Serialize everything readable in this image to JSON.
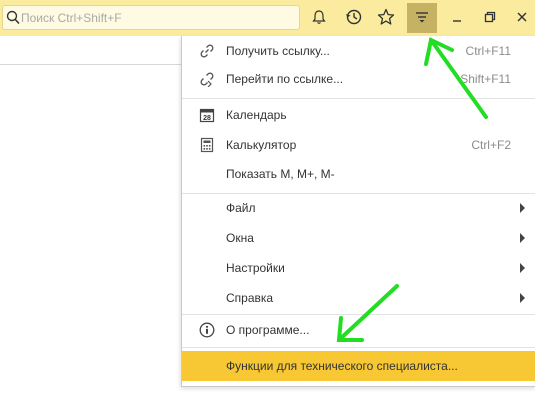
{
  "search": {
    "placeholder": "Поиск Ctrl+Shift+F",
    "value": ""
  },
  "toolbar": {
    "buttons": [
      {
        "name": "notifications-icon"
      },
      {
        "name": "history-icon"
      },
      {
        "name": "favorites-icon"
      },
      {
        "name": "main-menu-icon",
        "active": true
      },
      {
        "name": "minimize-icon"
      },
      {
        "name": "restore-icon"
      },
      {
        "name": "close-icon"
      }
    ]
  },
  "menu": {
    "items": [
      {
        "label": "Получить ссылку...",
        "shortcut": "Ctrl+F11",
        "icon": "link-icon"
      },
      {
        "label": "Перейти по ссылке...",
        "shortcut": "Shift+F11",
        "icon": "follow-link-icon"
      },
      {
        "label": "Календарь",
        "shortcut": "",
        "icon": "calendar-icon"
      },
      {
        "label": "Калькулятор",
        "shortcut": "Ctrl+F2",
        "icon": "calculator-icon"
      },
      {
        "label": "Показать M, M+, M-",
        "shortcut": "",
        "icon": ""
      },
      {
        "label": "Файл",
        "shortcut": "",
        "submenu": true
      },
      {
        "label": "Окна",
        "shortcut": "",
        "submenu": true
      },
      {
        "label": "Настройки",
        "shortcut": "",
        "submenu": true
      },
      {
        "label": "Справка",
        "shortcut": "",
        "submenu": true
      },
      {
        "label": "О программе...",
        "shortcut": "",
        "icon": "info-icon"
      },
      {
        "label": "Функции для технического специалиста...",
        "shortcut": "",
        "highlighted": true
      }
    ]
  },
  "colors": {
    "titlebar": "#fbeb9f",
    "active_button": "#c5b262",
    "highlight": "#f7c833",
    "annotation_arrow": "#22dd22"
  }
}
